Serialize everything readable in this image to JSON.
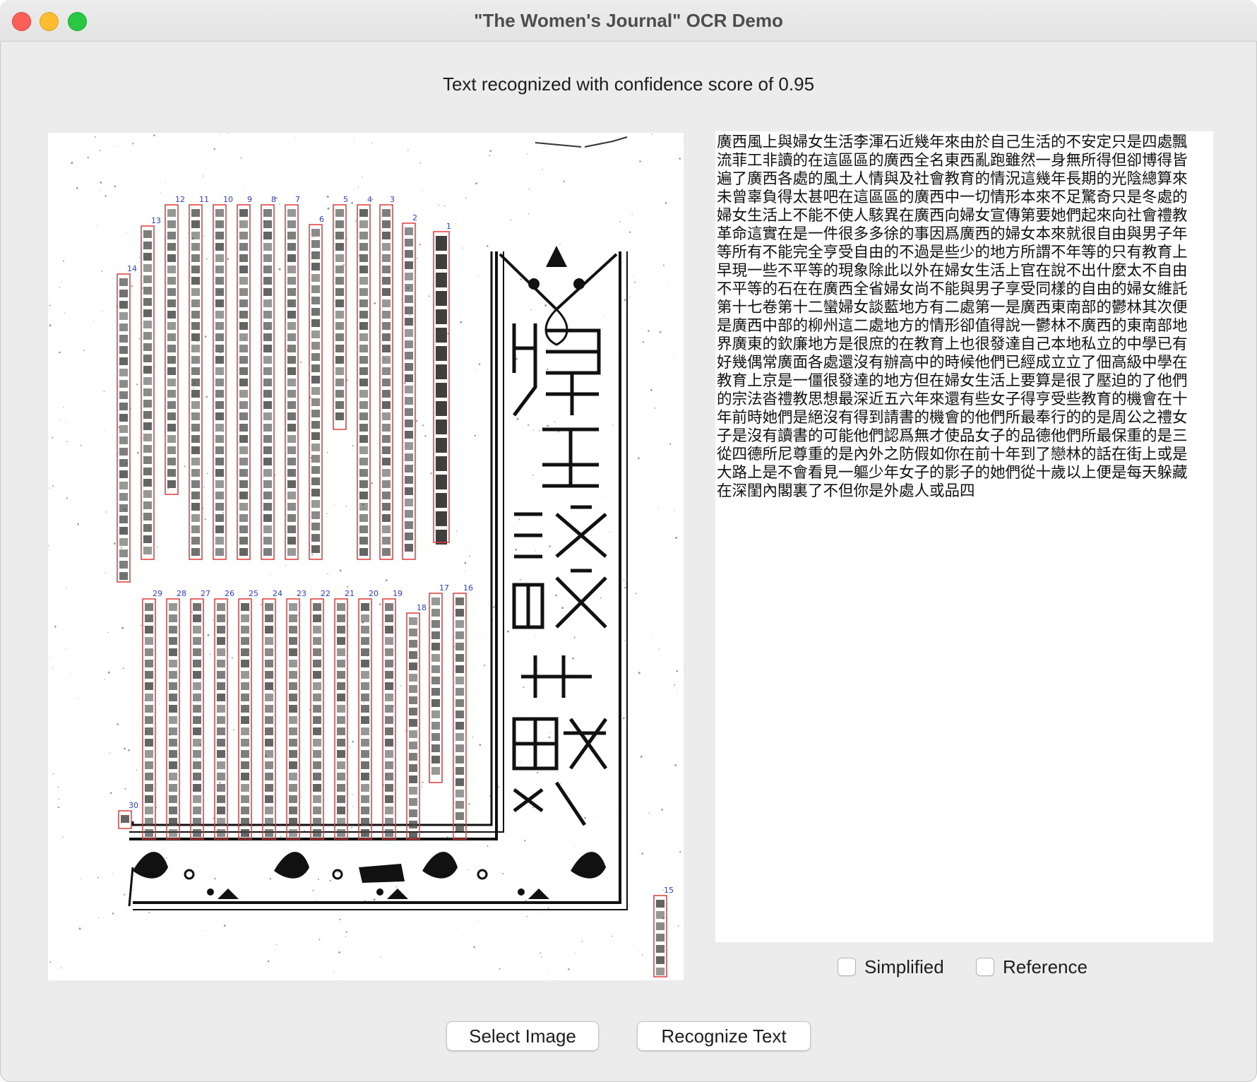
{
  "window": {
    "title": "\"The Women's Journal\" OCR Demo",
    "controls": [
      "close",
      "minimize",
      "zoom"
    ]
  },
  "status_text": "Text recognized with confidence score of 0.95",
  "image_panel": {
    "description_icon": "scanned-newspaper-page",
    "region_labels_top": [
      "1",
      "2",
      "3",
      "4",
      "5",
      "6",
      "7",
      "8",
      "9",
      "10",
      "11",
      "12",
      "13",
      "14"
    ],
    "region_labels_bottom": [
      "16",
      "17",
      "18",
      "19",
      "20",
      "21",
      "22",
      "23",
      "24",
      "25",
      "26",
      "27",
      "28",
      "29",
      "30"
    ],
    "region_label_far": "15",
    "headline_vertical": "廣西風土與婦女生活",
    "author_vertical": "李渾石",
    "colors": {
      "box": "#e23b3b",
      "label": "#2a3cd8"
    }
  },
  "ocr_text": "廣西風上與婦女生活李渾石近幾年來由於自己生活的不安定只是四處飄流菲工非讀的在這區區的廣西全名東西亂跑雖然一身無所得但卻博得皆遍了廣西各處的風土人情與及社會教育的情況這幾年長期的光陰總算來未曾辜負得太甚吧在這區區的廣西中一切情形本來不足驚奇只是冬處的婦女生活上不能不使人駭異在廣西向婦女宣傳第要她們起來向社會禮教革命這實在是一件很多多徐的事因爲廣西的婦女本來就很自由與男子年等所有不能完全亨受自由的不過是些少的地方所謂不年等的只有教育上早現一些不平等的現象除此以外在婦女生活上官在說不出什麼太不自由不平等的石在在廣西全省婦女尚不能與男子享受同樣的自由的婦女維託第十七卷第十二蠻婦女談藍地方有二處第一是廣西東南部的鬱林其次便是廣西中部的柳州這二處地方的情形卻值得說一鬱林不廣西的東南部地界廣東的欽廉地方是很庶的在教育上也很發達自己本地私立的中學已有好幾偶常廣面各處還沒有辦高中的時候他們已經成立立了佃高級中學在教育上京是一僵很發達的地方但在婦女生活上要算是很了壓迫的了他們的宗法沓禮教思想最深近五六年來還有些女子得亨受些教育的機會在十年前時她們是絕沒有得到請書的機會的他們所最奉行的的是周公之禮女子是沒有讀書的可能他們認爲無才使品女子的品德他們所最保重的是三從四德所尼尊重的是內外之防假如你在前十年到了戀林的話在街上或是大路上是不會看見一軀少年女子的影子的她們從十歲以上便是每天躲藏在深閨內閣裏了不但你是外處人或品四",
  "options": {
    "simplified": {
      "label": "Simplified",
      "checked": false
    },
    "reference": {
      "label": "Reference",
      "checked": false
    }
  },
  "buttons": {
    "select_image": "Select Image",
    "recognize_text": "Recognize Text"
  }
}
